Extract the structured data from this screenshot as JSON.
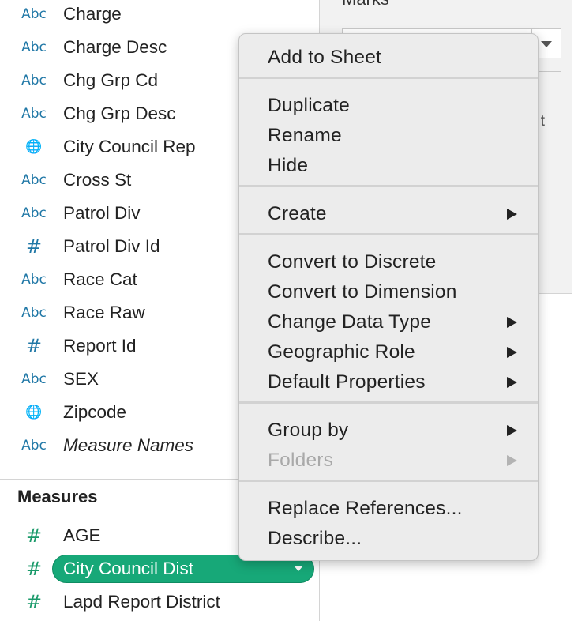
{
  "dimensions": [
    {
      "icon": "Abc",
      "icon_name": "string-type-icon",
      "label": "Charge"
    },
    {
      "icon": "Abc",
      "icon_name": "string-type-icon",
      "label": "Charge Desc"
    },
    {
      "icon": "Abc",
      "icon_name": "string-type-icon",
      "label": "Chg Grp Cd"
    },
    {
      "icon": "Abc",
      "icon_name": "string-type-icon",
      "label": "Chg Grp Desc"
    },
    {
      "icon": "🌐",
      "icon_name": "globe-icon",
      "label": "City Council Rep"
    },
    {
      "icon": "Abc",
      "icon_name": "string-type-icon",
      "label": "Cross St"
    },
    {
      "icon": "Abc",
      "icon_name": "string-type-icon",
      "label": "Patrol Div"
    },
    {
      "icon": "#",
      "icon_name": "number-type-icon",
      "label": "Patrol Div Id"
    },
    {
      "icon": "Abc",
      "icon_name": "string-type-icon",
      "label": "Race Cat"
    },
    {
      "icon": "Abc",
      "icon_name": "string-type-icon",
      "label": "Race Raw"
    },
    {
      "icon": "#",
      "icon_name": "number-type-icon",
      "label": "Report Id"
    },
    {
      "icon": "Abc",
      "icon_name": "string-type-icon",
      "label": "SEX"
    },
    {
      "icon": "🌐",
      "icon_name": "globe-icon",
      "label": "Zipcode"
    },
    {
      "icon": "Abc",
      "icon_name": "string-type-icon",
      "label": "Measure Names"
    }
  ],
  "measures_header": "Measures",
  "measures": [
    {
      "icon": "#",
      "label": "AGE",
      "selected": false
    },
    {
      "icon": "#",
      "label": "City Council Dist",
      "selected": true
    },
    {
      "icon": "#",
      "label": "Lapd Report District",
      "selected": false
    }
  ],
  "marks_pane": {
    "label": "Marks",
    "box_text": "t"
  },
  "context_menu": {
    "groups": [
      [
        {
          "label": "Add to Sheet",
          "submenu": false,
          "disabled": false
        }
      ],
      [
        {
          "label": "Duplicate",
          "submenu": false,
          "disabled": false
        },
        {
          "label": "Rename",
          "submenu": false,
          "disabled": false
        },
        {
          "label": "Hide",
          "submenu": false,
          "disabled": false
        }
      ],
      [
        {
          "label": "Create",
          "submenu": true,
          "disabled": false
        }
      ],
      [
        {
          "label": "Convert to Discrete",
          "submenu": false,
          "disabled": false
        },
        {
          "label": "Convert to Dimension",
          "submenu": false,
          "disabled": false
        },
        {
          "label": "Change Data Type",
          "submenu": true,
          "disabled": false
        },
        {
          "label": "Geographic Role",
          "submenu": true,
          "disabled": false
        },
        {
          "label": "Default Properties",
          "submenu": true,
          "disabled": false
        }
      ],
      [
        {
          "label": "Group by",
          "submenu": true,
          "disabled": false
        },
        {
          "label": "Folders",
          "submenu": true,
          "disabled": true
        }
      ],
      [
        {
          "label": "Replace References...",
          "submenu": false,
          "disabled": false
        },
        {
          "label": "Describe...",
          "submenu": false,
          "disabled": false
        }
      ]
    ]
  },
  "colors": {
    "dimension_icon": "#1f77a6",
    "measure_icon": "#1a9a6a",
    "selected_pill": "#17a878",
    "menu_background": "#ececec",
    "disabled_text": "#a9a9a9"
  }
}
